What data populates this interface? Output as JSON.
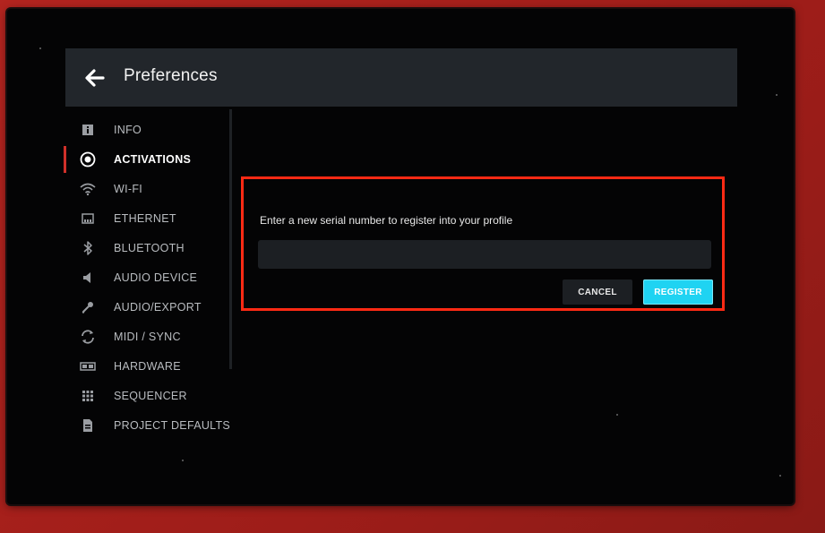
{
  "header": {
    "title": "Preferences",
    "back_icon": "arrow-left-icon"
  },
  "sidebar": {
    "items": [
      {
        "label": "INFO",
        "icon": "info-icon",
        "active": false
      },
      {
        "label": "ACTIVATIONS",
        "icon": "activations-icon",
        "active": true
      },
      {
        "label": "WI-FI",
        "icon": "wifi-icon",
        "active": false
      },
      {
        "label": "ETHERNET",
        "icon": "ethernet-icon",
        "active": false
      },
      {
        "label": "BLUETOOTH",
        "icon": "bluetooth-icon",
        "active": false
      },
      {
        "label": "AUDIO DEVICE",
        "icon": "speaker-icon",
        "active": false
      },
      {
        "label": "AUDIO/EXPORT",
        "icon": "microphone-icon",
        "active": false
      },
      {
        "label": "MIDI / SYNC",
        "icon": "sync-icon",
        "active": false
      },
      {
        "label": "HARDWARE",
        "icon": "hardware-icon",
        "active": false
      },
      {
        "label": "SEQUENCER",
        "icon": "sequencer-grid-icon",
        "active": false
      },
      {
        "label": "PROJECT DEFAULTS",
        "icon": "document-icon",
        "active": false
      }
    ]
  },
  "dialog": {
    "prompt": "Enter a new serial number to register into your profile",
    "serial_value": "",
    "cancel_label": "CANCEL",
    "register_label": "REGISTER"
  },
  "colors": {
    "accent": "#1fd3f2",
    "active_indicator": "#d0302a",
    "highlight_border": "#ff2a14",
    "device_body": "#a8211c"
  }
}
